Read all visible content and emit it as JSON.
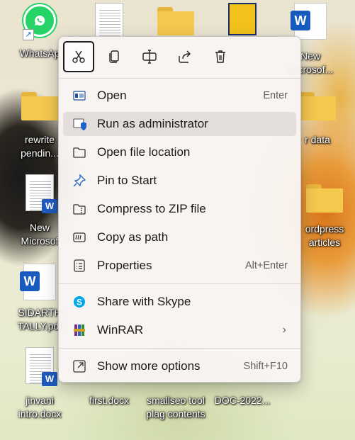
{
  "desktop": {
    "icons": [
      {
        "label": "WhatsAp",
        "label2": ""
      },
      {
        "label": "New",
        "label2": "Microsof..."
      },
      {
        "label": "rewrite",
        "label2": "pendin..."
      },
      {
        "label": "r data",
        "label2": ""
      },
      {
        "label": "New",
        "label2": "Microsof"
      },
      {
        "label": "ordpress",
        "label2": "articles"
      },
      {
        "label": "SIDARTH",
        "label2": "TALLY.pdf"
      },
      {
        "label": "jinvani",
        "label2": "intro.docx"
      },
      {
        "label": "first.docx",
        "label2": ""
      },
      {
        "label": "smallseo tool",
        "label2": "plag contents"
      },
      {
        "label": "DOC-2022...",
        "label2": ""
      }
    ]
  },
  "context_menu": {
    "toolbar": [
      {
        "name": "cut",
        "icon": "scissors-icon"
      },
      {
        "name": "copy",
        "icon": "copy-icon"
      },
      {
        "name": "rename",
        "icon": "rename-icon"
      },
      {
        "name": "share",
        "icon": "share-icon"
      },
      {
        "name": "delete",
        "icon": "trash-icon"
      }
    ],
    "items": [
      {
        "label": "Open",
        "shortcut": "Enter",
        "icon": "open-app-icon"
      },
      {
        "label": "Run as administrator",
        "shortcut": "",
        "icon": "shield-icon"
      },
      {
        "label": "Open file location",
        "shortcut": "",
        "icon": "folder-open-icon"
      },
      {
        "label": "Pin to Start",
        "shortcut": "",
        "icon": "pin-icon"
      },
      {
        "label": "Compress to ZIP file",
        "shortcut": "",
        "icon": "zip-folder-icon"
      },
      {
        "label": "Copy as path",
        "shortcut": "",
        "icon": "copy-path-icon"
      },
      {
        "label": "Properties",
        "shortcut": "Alt+Enter",
        "icon": "properties-icon"
      },
      {
        "label": "Share with Skype",
        "shortcut": "",
        "icon": "skype-icon"
      },
      {
        "label": "WinRAR",
        "shortcut": "",
        "icon": "winrar-icon",
        "submenu": "›"
      },
      {
        "label": "Show more options",
        "shortcut": "Shift+F10",
        "icon": "more-options-icon"
      }
    ],
    "accent_color": "#0067c0"
  }
}
